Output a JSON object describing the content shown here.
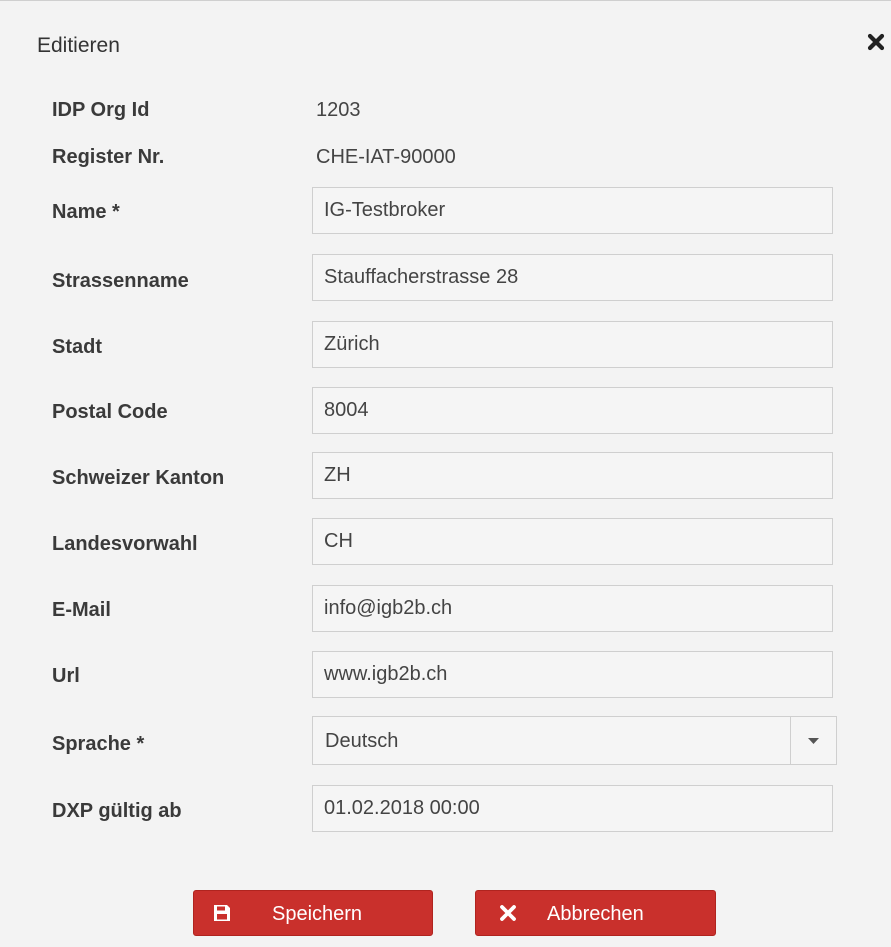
{
  "dialog": {
    "title": "Editieren"
  },
  "info": [
    {
      "label": "IDP Org Id",
      "value": "1203"
    },
    {
      "label": "Register Nr.",
      "value": "CHE-IAT-90000"
    }
  ],
  "fields": [
    {
      "label": "Name *",
      "value": "IG-Testbroker"
    },
    {
      "label": "Strassenname",
      "value": "Stauffacherstrasse 28"
    },
    {
      "label": "Stadt",
      "value": "Zürich"
    },
    {
      "label": "Postal Code",
      "value": "8004"
    },
    {
      "label": "Schweizer Kanton",
      "value": "ZH"
    },
    {
      "label": "Landesvorwahl",
      "value": "CH"
    },
    {
      "label": "E-Mail",
      "value": "info@igb2b.ch"
    },
    {
      "label": "Url",
      "value": "www.igb2b.ch"
    }
  ],
  "language": {
    "label": "Sprache *",
    "value": "Deutsch"
  },
  "dxp": {
    "label": "DXP gültig ab",
    "value": "01.02.2018 00:00"
  },
  "buttons": {
    "save_label": "Speichern",
    "cancel_label": "Abbrechen"
  },
  "colors": {
    "button_bg": "#c9302c",
    "field_bg": "#f5f5f5",
    "page_bg": "#f3f3f3"
  },
  "icons": {
    "close": "close-icon",
    "save": "floppy-disk-icon",
    "cancel": "x-icon",
    "dropdown": "caret-down-icon"
  }
}
